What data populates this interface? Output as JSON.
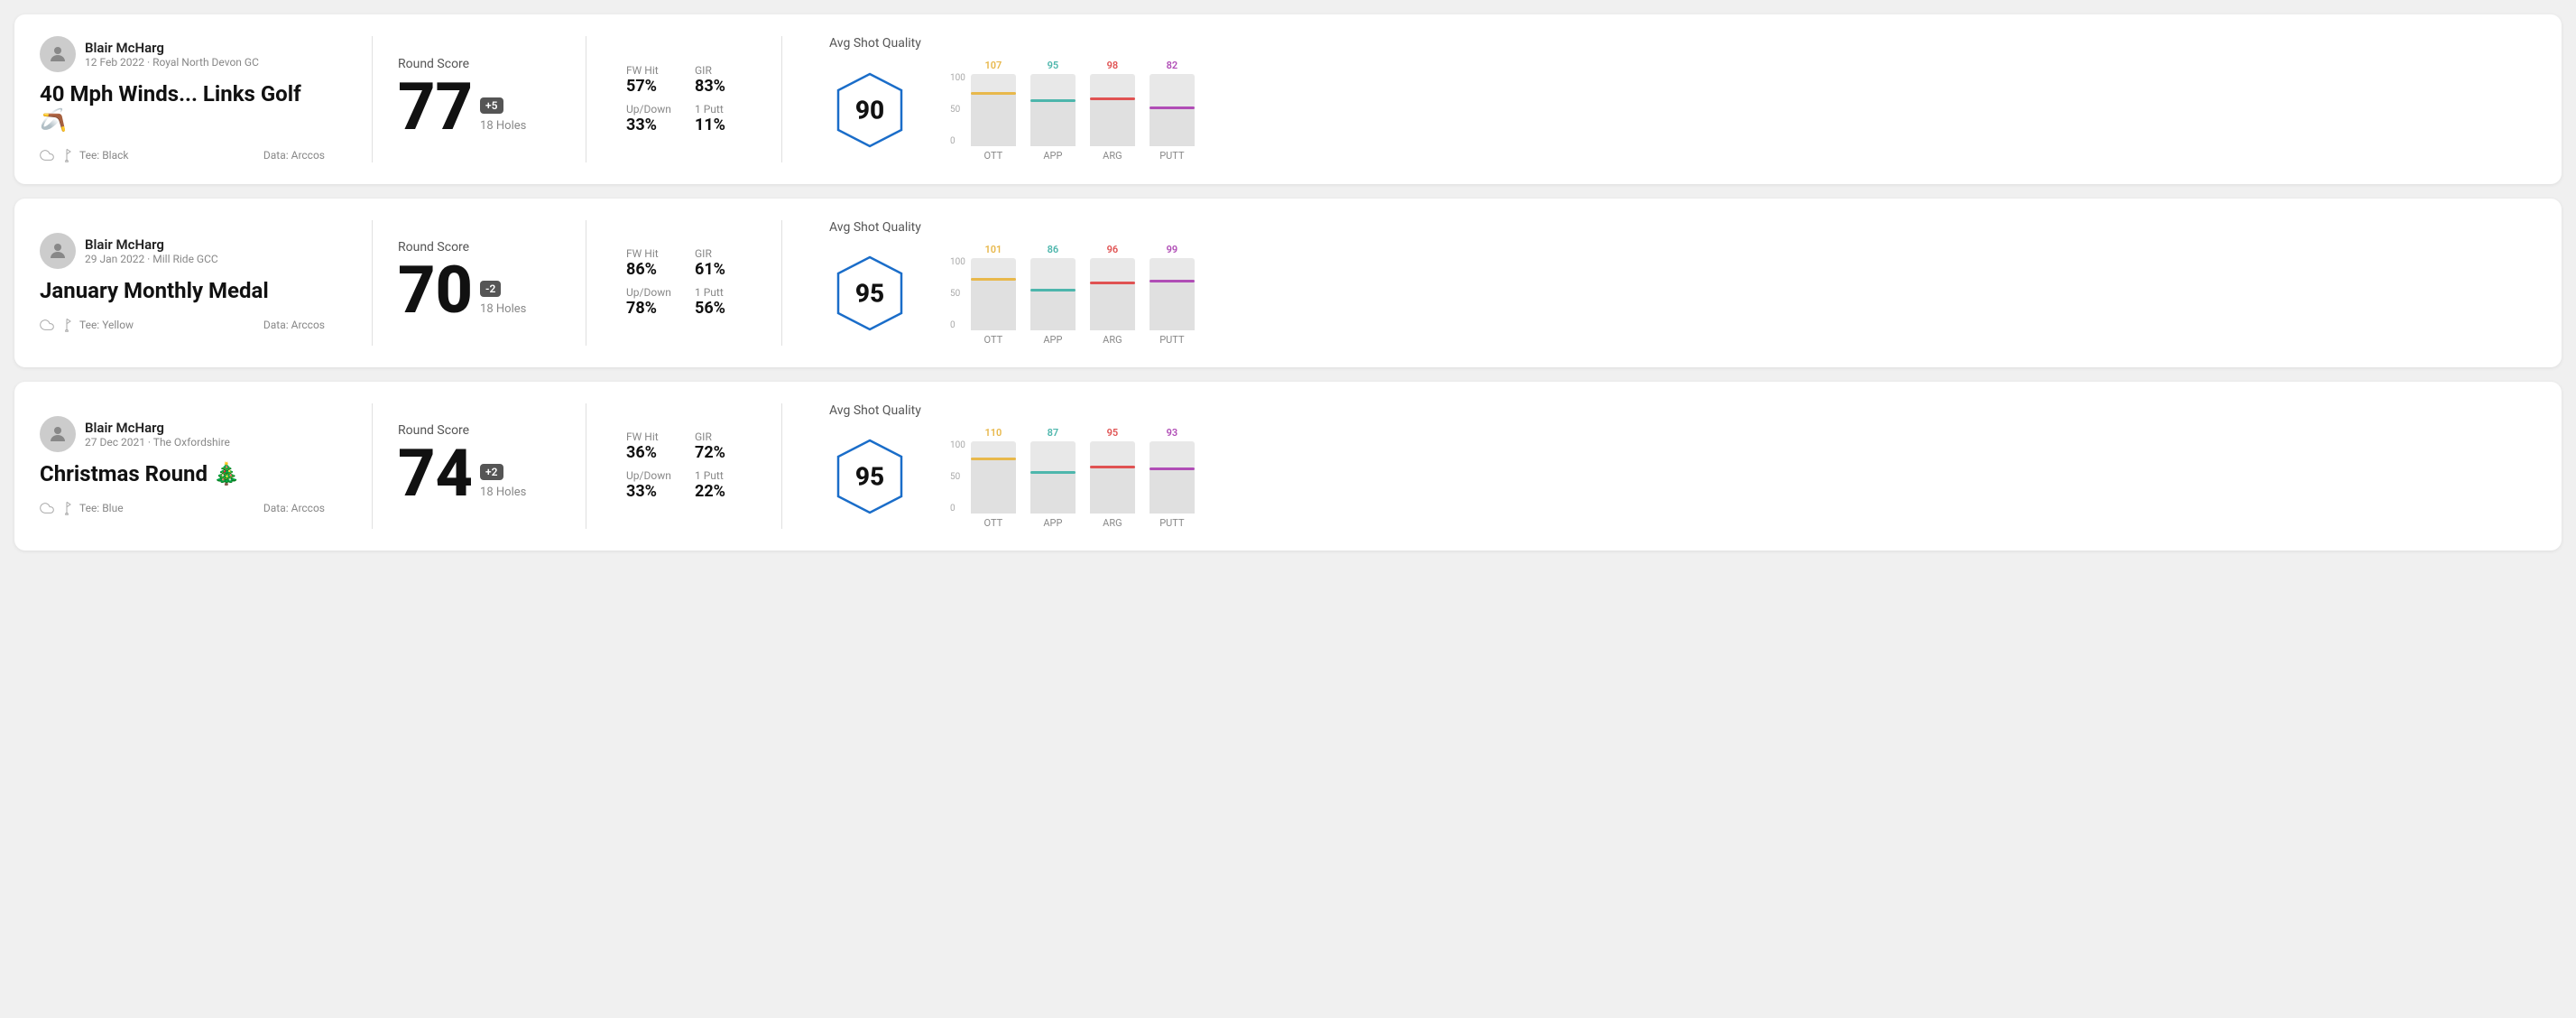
{
  "rounds": [
    {
      "id": "round-1",
      "user": {
        "name": "Blair McHarg",
        "meta": "12 Feb 2022 · Royal North Devon GC"
      },
      "title": "40 Mph Winds... Links Golf 🪃",
      "tee": "Black",
      "data_source": "Data: Arccos",
      "score": {
        "value": "77",
        "badge": "+5",
        "holes": "18 Holes"
      },
      "stats": {
        "fw_hit_label": "FW Hit",
        "fw_hit_value": "57%",
        "gir_label": "GIR",
        "gir_value": "83%",
        "updown_label": "Up/Down",
        "updown_value": "33%",
        "oneputt_label": "1 Putt",
        "oneputt_value": "11%"
      },
      "avg_shot_quality": {
        "label": "Avg Shot Quality",
        "value": "90",
        "bars": [
          {
            "label": "OTT",
            "value": 107,
            "color": "#e8b84b",
            "height_pct": 75
          },
          {
            "label": "APP",
            "value": 95,
            "color": "#4db6ac",
            "height_pct": 65
          },
          {
            "label": "ARG",
            "value": 98,
            "color": "#e05252",
            "height_pct": 68
          },
          {
            "label": "PUTT",
            "value": 82,
            "color": "#b04db6",
            "height_pct": 55
          }
        ]
      }
    },
    {
      "id": "round-2",
      "user": {
        "name": "Blair McHarg",
        "meta": "29 Jan 2022 · Mill Ride GCC"
      },
      "title": "January Monthly Medal",
      "tee": "Yellow",
      "data_source": "Data: Arccos",
      "score": {
        "value": "70",
        "badge": "-2",
        "holes": "18 Holes"
      },
      "stats": {
        "fw_hit_label": "FW Hit",
        "fw_hit_value": "86%",
        "gir_label": "GIR",
        "gir_value": "61%",
        "updown_label": "Up/Down",
        "updown_value": "78%",
        "oneputt_label": "1 Putt",
        "oneputt_value": "56%"
      },
      "avg_shot_quality": {
        "label": "Avg Shot Quality",
        "value": "95",
        "bars": [
          {
            "label": "OTT",
            "value": 101,
            "color": "#e8b84b",
            "height_pct": 72
          },
          {
            "label": "APP",
            "value": 86,
            "color": "#4db6ac",
            "height_pct": 58
          },
          {
            "label": "ARG",
            "value": 96,
            "color": "#e05252",
            "height_pct": 67
          },
          {
            "label": "PUTT",
            "value": 99,
            "color": "#b04db6",
            "height_pct": 70
          }
        ]
      }
    },
    {
      "id": "round-3",
      "user": {
        "name": "Blair McHarg",
        "meta": "27 Dec 2021 · The Oxfordshire"
      },
      "title": "Christmas Round 🎄",
      "tee": "Blue",
      "data_source": "Data: Arccos",
      "score": {
        "value": "74",
        "badge": "+2",
        "holes": "18 Holes"
      },
      "stats": {
        "fw_hit_label": "FW Hit",
        "fw_hit_value": "36%",
        "gir_label": "GIR",
        "gir_value": "72%",
        "updown_label": "Up/Down",
        "updown_value": "33%",
        "oneputt_label": "1 Putt",
        "oneputt_value": "22%"
      },
      "avg_shot_quality": {
        "label": "Avg Shot Quality",
        "value": "95",
        "bars": [
          {
            "label": "OTT",
            "value": 110,
            "color": "#e8b84b",
            "height_pct": 78
          },
          {
            "label": "APP",
            "value": 87,
            "color": "#4db6ac",
            "height_pct": 59
          },
          {
            "label": "ARG",
            "value": 95,
            "color": "#e05252",
            "height_pct": 66
          },
          {
            "label": "PUTT",
            "value": 93,
            "color": "#b04db6",
            "height_pct": 64
          }
        ]
      }
    }
  ],
  "labels": {
    "round_score": "Round Score",
    "avg_shot_quality": "Avg Shot Quality",
    "tee_prefix": "Tee:",
    "data_arccos": "Data: Arccos",
    "y_axis": [
      "100",
      "50",
      "0"
    ]
  }
}
